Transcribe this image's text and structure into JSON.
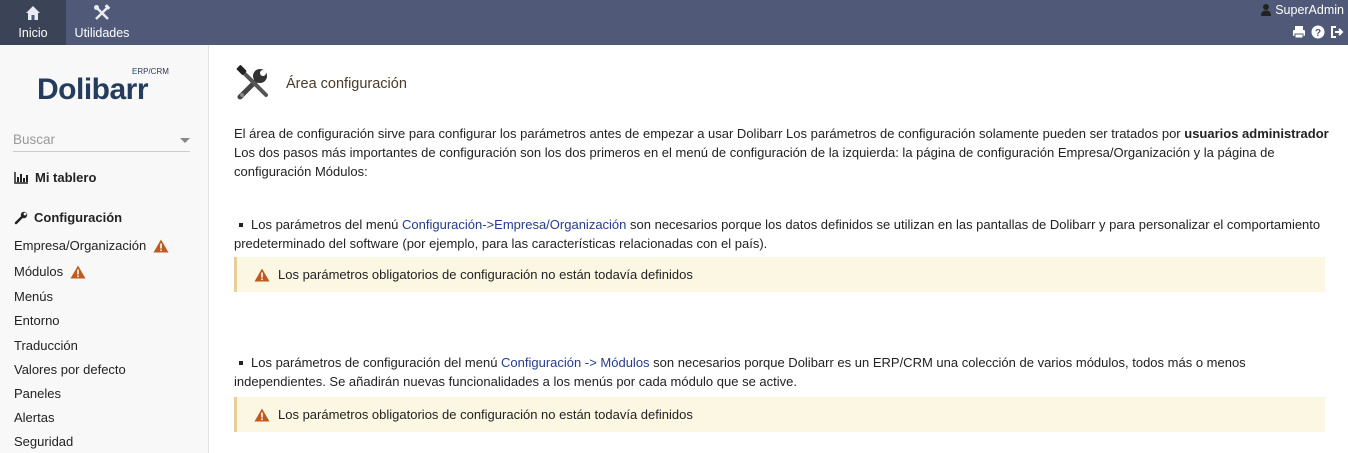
{
  "topnav": {
    "items": [
      {
        "label": "Inicio",
        "icon": "home-icon",
        "active": true
      },
      {
        "label": "Utilidades",
        "icon": "tools-icon",
        "active": false
      }
    ],
    "user": "SuperAdmin",
    "tool_icons": [
      "print-icon",
      "help-icon",
      "logout-icon"
    ]
  },
  "sidebar": {
    "logo": {
      "main": "Dolibarr",
      "sub": "ERP/CRM"
    },
    "search_placeholder": "Buscar",
    "sections": [
      {
        "label": "Mi tablero",
        "icon": "chart-icon"
      },
      {
        "label": "Configuración",
        "icon": "wrench-icon"
      }
    ],
    "items": [
      {
        "label": "Empresa/Organización",
        "warning": true
      },
      {
        "label": "Módulos",
        "warning": true
      },
      {
        "label": "Menús",
        "warning": false
      },
      {
        "label": "Entorno",
        "warning": false
      },
      {
        "label": "Traducción",
        "warning": false
      },
      {
        "label": "Valores por defecto",
        "warning": false
      },
      {
        "label": "Paneles",
        "warning": false
      },
      {
        "label": "Alertas",
        "warning": false
      },
      {
        "label": "Seguridad",
        "warning": false
      }
    ]
  },
  "main": {
    "title": "Área configuración",
    "intro": {
      "part1": "El área de configuración sirve para configurar los parámetros antes de empezar a usar Dolibarr Los parámetros de configuración solamente pueden ser tratados por ",
      "bold": "usuarios administrador",
      "part2": "Los dos pasos más importantes de configuración son los dos primeros en el menú de configuración de la izquierda: la página de configuración Empresa/Organización y la página de configuración Módulos:"
    },
    "bullet1": {
      "before": "Los parámetros del menú ",
      "link": "Configuración->Empresa/Organización",
      "after": " son necesarios porque los datos definidos se utilizan en las pantallas de Dolibarr y para personalizar el comportamiento predeterminado del software (por ejemplo, para las características relacionadas con el país)."
    },
    "warning1": "Los parámetros obligatorios de configuración no están todavía definidos",
    "bullet2": {
      "before": "Los parámetros de configuración del menú ",
      "link": "Configuración -> Módulos",
      "after": " son necesarios porque Dolibarr es un ERP/CRM una colección de varios módulos, todos más o menos independientes. Se añadirán nuevas funcionalidades a los menús por cada módulo que se active."
    },
    "warning2": "Los parámetros obligatorios de configuración no están todavía definidos"
  },
  "colors": {
    "topbar": "#505a78",
    "topbar_active": "#3b4356",
    "warning_bg": "#fcf7e3",
    "warning_icon": "#c05a1e",
    "link": "#263c8c"
  }
}
